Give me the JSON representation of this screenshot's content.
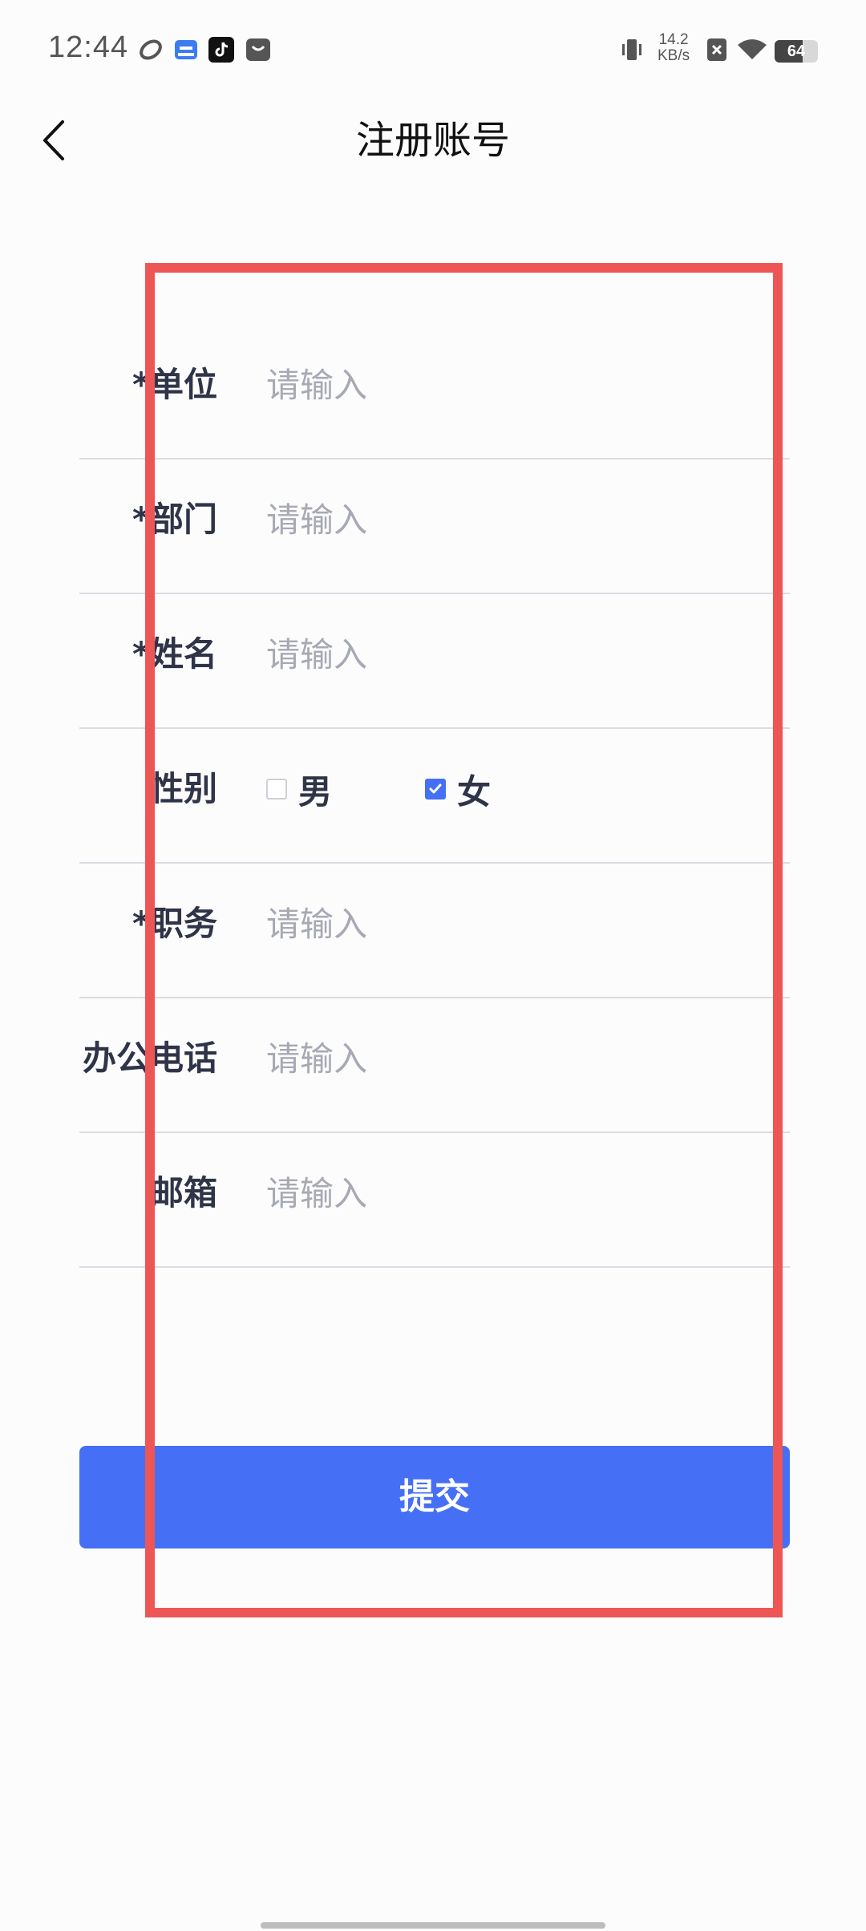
{
  "status_bar": {
    "time": "12:44",
    "net_speed_value": "14.2",
    "net_speed_unit": "KB/s",
    "battery_level": "64",
    "battery_fraction": 0.64
  },
  "header": {
    "title": "注册账号"
  },
  "form": {
    "fields": [
      {
        "label": "*单位",
        "placeholder": "请输入"
      },
      {
        "label": "*部门",
        "placeholder": "请输入"
      },
      {
        "label": "*姓名",
        "placeholder": "请输入"
      },
      {
        "label": "性别"
      },
      {
        "label": "*职务",
        "placeholder": "请输入"
      },
      {
        "label": "办公电话",
        "placeholder": "请输入"
      },
      {
        "label": "邮箱",
        "placeholder": "请输入"
      }
    ],
    "gender": {
      "options": [
        {
          "label": "男",
          "checked": false
        },
        {
          "label": "女",
          "checked": true
        }
      ]
    }
  },
  "submit": {
    "label": "提交"
  },
  "colors": {
    "primary": "#4570f5",
    "highlight_box": "#ee5656",
    "label_text": "#2f3448",
    "placeholder_text": "#a7a9b4",
    "divider": "#dcdde3"
  }
}
